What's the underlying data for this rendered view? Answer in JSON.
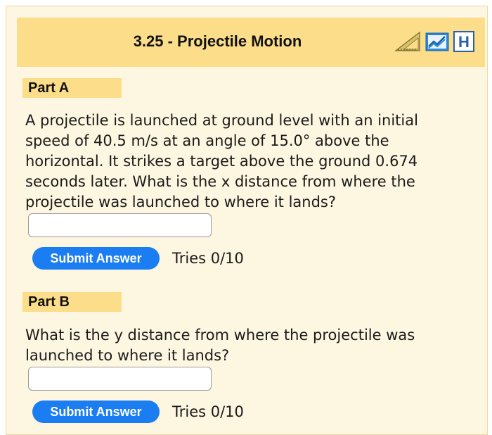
{
  "header": {
    "title": "3.25 - Projectile Motion",
    "icons": [
      "ruler-triangle-icon",
      "chart-book-icon",
      "hint-h-icon"
    ],
    "icon_h_text": "H"
  },
  "part_a": {
    "label": "Part A",
    "question": "A projectile is launched at ground level with an initial speed of 40.5 m/s at an angle of 15.0° above the horizontal. It strikes a target above the ground 0.674 seconds later. What is the x distance from where the projectile was launched to where it lands?",
    "input_value": "",
    "submit_label": "Submit Answer",
    "tries": "Tries 0/10"
  },
  "part_b": {
    "label": "Part B",
    "question": "What is the y distance from where the projectile was launched to where it lands?",
    "input_value": "",
    "submit_label": "Submit Answer",
    "tries": "Tries 0/10"
  },
  "colors": {
    "header_bg": "#fcde8a",
    "panel_bg": "#fdf6e0",
    "button_bg": "#1a7df2",
    "button_text": "#ffffff"
  }
}
